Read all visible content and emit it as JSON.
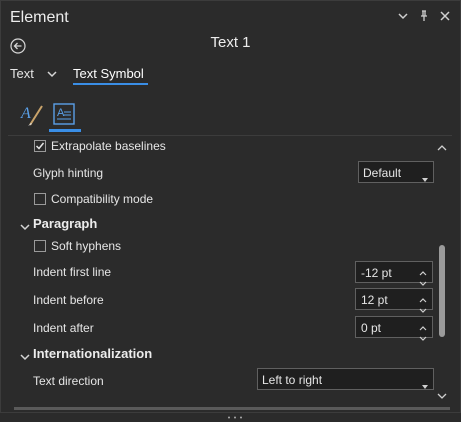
{
  "header": {
    "title": "Element",
    "subtitle": "Text 1"
  },
  "tabs": {
    "first": "Text",
    "second": "Text Symbol"
  },
  "rows": {
    "extrapolate": "Extrapolate baselines",
    "glyph_hinting": "Glyph hinting",
    "glyph_hinting_value": "Default",
    "compat": "Compatibility mode",
    "paragraph": "Paragraph",
    "soft_hyphens": "Soft hyphens",
    "indent_first": "Indent first line",
    "indent_first_value": "-12 pt",
    "indent_before": "Indent before",
    "indent_before_value": "12 pt",
    "indent_after": "Indent after",
    "indent_after_value": "0 pt",
    "intl": "Internationalization",
    "text_dir": "Text direction",
    "text_dir_value": "Left to right"
  },
  "icons": {
    "options": "chevron-down-icon",
    "pin": "pin-icon",
    "close": "close-icon",
    "back": "back-arrow-icon",
    "symbol_brush": "text-brush-icon",
    "text_props": "text-properties-icon"
  },
  "colors": {
    "accent": "#3a8ee6",
    "background": "#2b2b2b",
    "field": "#1f1f1f"
  }
}
